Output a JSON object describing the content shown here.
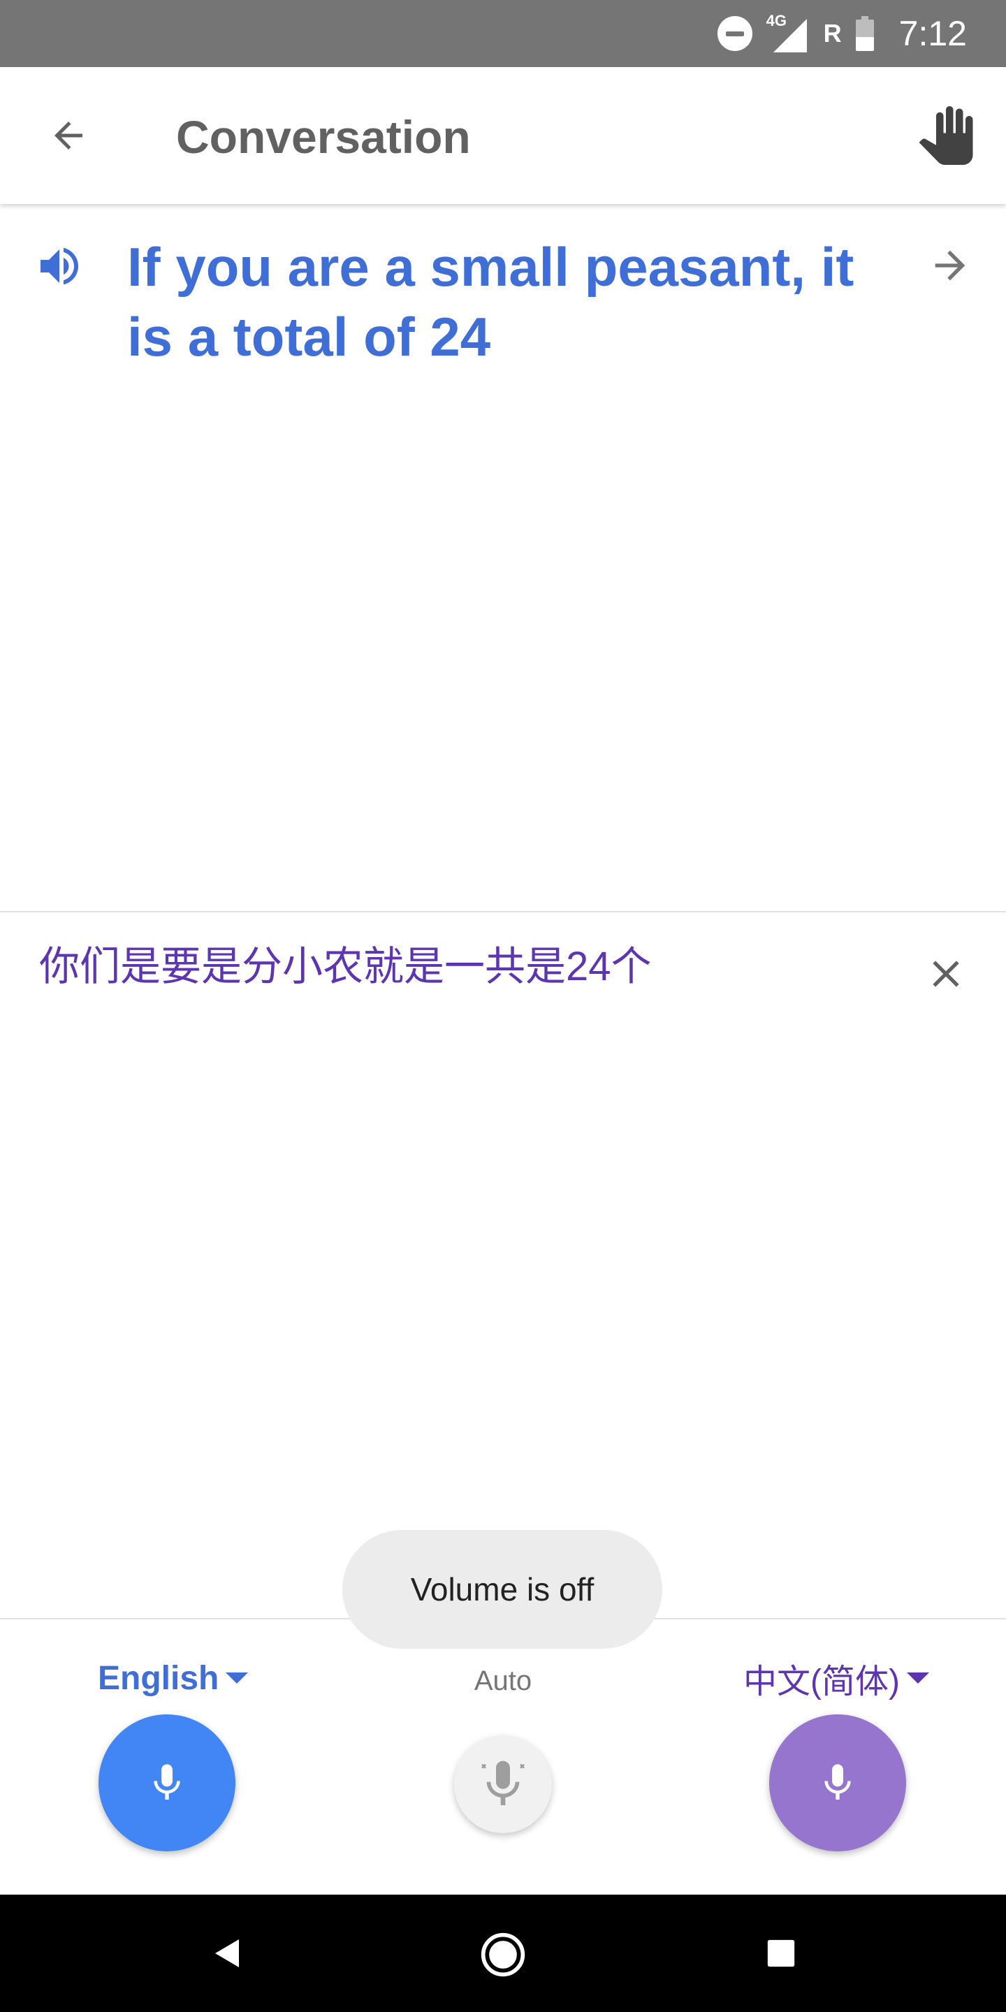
{
  "status_bar": {
    "network": "4G",
    "roaming": "R",
    "time": "7:12"
  },
  "app_bar": {
    "title": "Conversation"
  },
  "translation": {
    "text": "If you are a small peasant, it is a total of 24"
  },
  "source": {
    "text": "你们是要是分小农就是一共是24个"
  },
  "controls": {
    "left_language": "English",
    "auto_label": "Auto",
    "right_language": "中文(简体)"
  },
  "toast": {
    "message": "Volume is off"
  },
  "colors": {
    "english_accent": "#3f6fd6",
    "english_mic": "#4285f4",
    "chinese_accent": "#5e35b1",
    "chinese_mic": "#9575cd",
    "status_bar": "#757575"
  },
  "icons": {
    "back": "arrow-left-icon",
    "hand": "hand-icon",
    "speaker": "speaker-icon",
    "forward": "arrow-right-icon",
    "close": "close-icon",
    "mic": "microphone-icon",
    "auto_mic": "microphone-auto-icon"
  }
}
